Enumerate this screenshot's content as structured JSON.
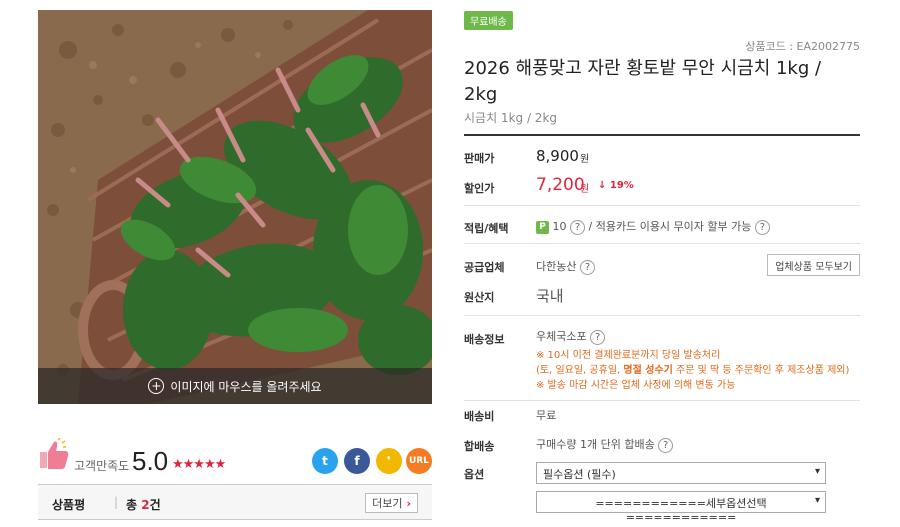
{
  "product": {
    "image_hint": "이미지에 마우스를 올려주세요",
    "free_shipping_badge": "무료배송",
    "product_code": "상품코드 : EA2002775",
    "title": "2026 해풍맞고 자란 황토밭 무안 시금치 1kg / 2kg",
    "subtitle": "시금치 1kg / 2kg"
  },
  "rating": {
    "label": "고객만족도",
    "score": "5.0",
    "stars": "★★★★★",
    "star_count": 5
  },
  "share": [
    {
      "name": "twitter",
      "glyph": "t",
      "color": "#2aa3ef"
    },
    {
      "name": "facebook",
      "glyph": "f",
      "color": "#3b5998"
    },
    {
      "name": "kakaostory",
      "glyph": "❜",
      "color": "#f2b800"
    },
    {
      "name": "url",
      "glyph": "URL",
      "color": "#f57c22"
    }
  ],
  "review": {
    "label": "상품평",
    "total_prefix": "총 ",
    "count": "2",
    "suffix": "건",
    "more": "더보기"
  },
  "price": {
    "sale_label": "판매가",
    "sale_value": "8,900",
    "sale_unit": "원",
    "discount_label": "할인가",
    "discount_value": "7,200",
    "discount_unit": "원",
    "discount_rate": "↓ 19%",
    "accent_color": "#e0243b"
  },
  "benefit": {
    "label": "적립/혜택",
    "points": "10",
    "slash": "/",
    "card_text": "적용카드 이용시 무이자 할부 가능"
  },
  "supplier": {
    "label": "공급업체",
    "value": "다한농산",
    "all_products": "업체상품 모두보기"
  },
  "origin": {
    "label": "원산지",
    "value": "국내"
  },
  "delivery": {
    "label": "배송정보",
    "carrier": "우체국소포",
    "note1": "※ 10시 이전 결제완료분까지 당일 발송처리",
    "note2_a": "(토, 일요일, 공휴일, ",
    "note2_b": "명절 성수기",
    "note2_c": " 주문 및 딱 등 주문확인 후 제조상품 제외)",
    "note3": "※ 발송 마감 시간은 업체 사정에 의해 변동 가능"
  },
  "shipping_fee": {
    "label": "배송비",
    "value": "무료"
  },
  "combined": {
    "label": "합배송",
    "value": "구매수량 1개 단위 합배송"
  },
  "options": {
    "label": "옵션",
    "required": "필수옵션 (필수)",
    "sub": "============세부옵션선택============"
  }
}
